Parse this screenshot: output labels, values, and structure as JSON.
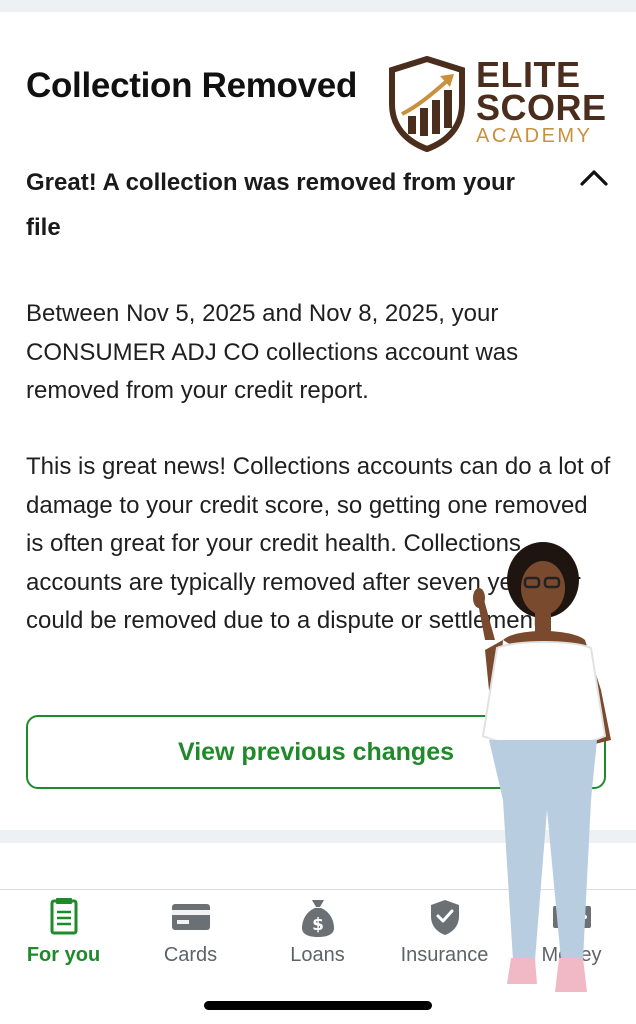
{
  "header": {
    "title": "Collection Removed"
  },
  "logo": {
    "line1": "ELITE",
    "line2": "SCORE",
    "line3": "ACADEMY"
  },
  "notice": {
    "subhead": "Great! A collection was removed from your file",
    "paragraph1": "Between Nov 5, 2025 and Nov 8, 2025, your CONSUMER ADJ CO collections account was removed from your credit report.",
    "paragraph2": "This is great news! Collections accounts can do a lot of damage to your credit score, so getting one removed is often great for your credit health. Collections accounts are typically removed after seven years, or could be removed due to a dispute or settlement."
  },
  "actions": {
    "view_previous": "View previous changes"
  },
  "nav": {
    "items": [
      {
        "label": "For you",
        "icon": "document-icon",
        "active": true
      },
      {
        "label": "Cards",
        "icon": "credit-card-icon",
        "active": false
      },
      {
        "label": "Loans",
        "icon": "money-bag-icon",
        "active": false
      },
      {
        "label": "Insurance",
        "icon": "shield-check-icon",
        "active": false
      },
      {
        "label": "Money",
        "icon": "cash-icon",
        "active": false
      }
    ]
  },
  "colors": {
    "accent": "#1f8a2a",
    "nav_inactive": "#5f6368",
    "logo_brown": "#4a2d1c",
    "logo_gold": "#c9913e"
  }
}
